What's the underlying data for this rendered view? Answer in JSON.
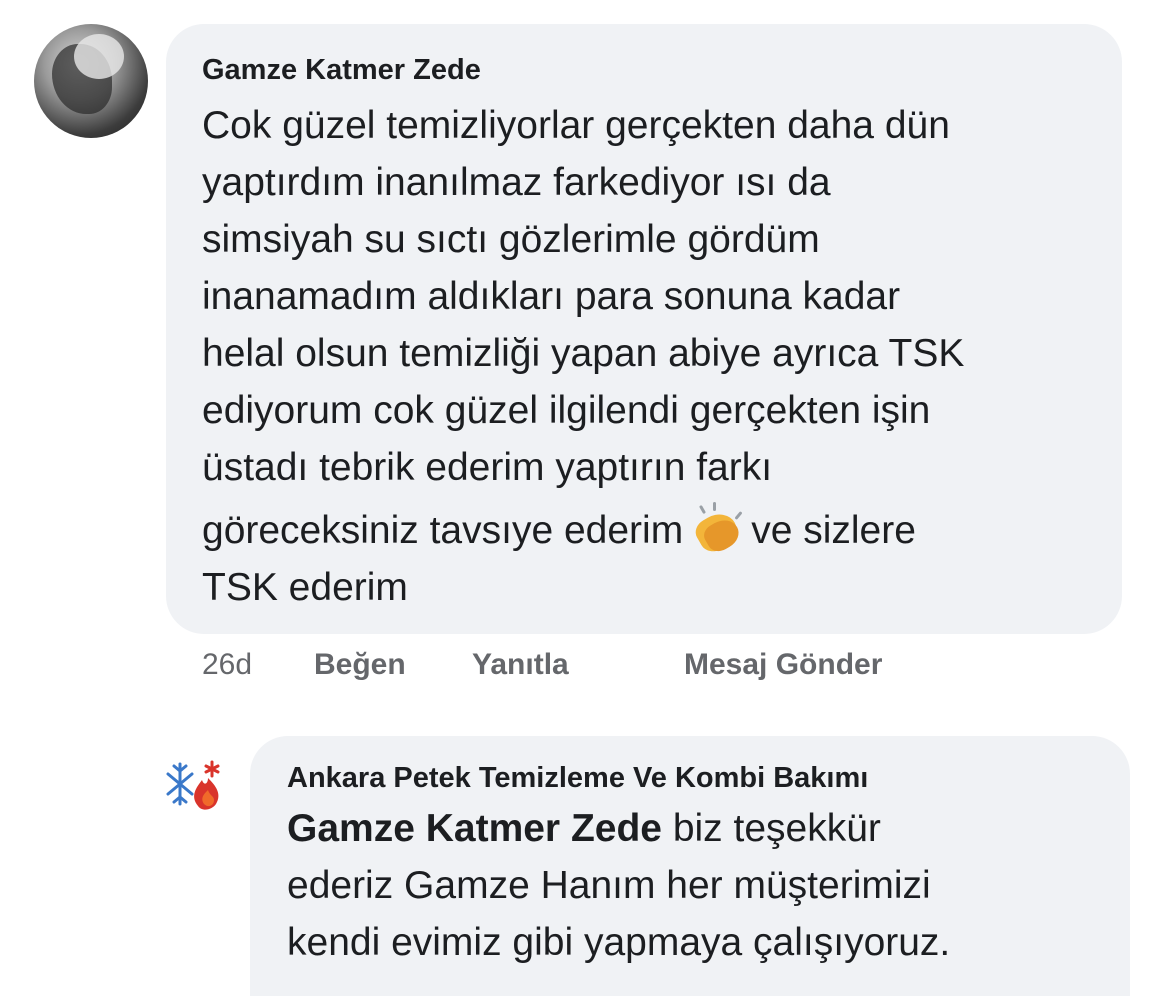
{
  "comment": {
    "author": "Gamze Katmer Zede",
    "lines": [
      "Cok güzel temizliyorlar gerçekten daha dün",
      "yaptırdım inanılmaz farkediyor ısı da",
      "simsiyah su sıctı gözlerimle gördüm",
      "inanamadım aldıkları para sonuna kadar",
      "helal olsun temizliği yapan abiye ayrıca TSK",
      "ediyorum cok güzel ilgilendi gerçekten işin",
      "üstadı tebrik ederim yaptırın farkı"
    ],
    "line8_before_emoji": "göreceksiniz tavsıye ederim",
    "emoji": "clapping-hands",
    "line8_after_emoji": "ve sizlere",
    "line9": "TSK ederim",
    "time": "26d",
    "like_label": "Beğen",
    "reply_label": "Yanıtla",
    "message_label": "Mesaj Gönder"
  },
  "reply": {
    "author": "Ankara Petek Temizleme Ve Kombi Bakımı",
    "mention": "Gamze Katmer Zede",
    "line1_rest": " biz teşekkür",
    "lines": [
      "ederiz Gamze Hanım her müşterimizi",
      "kendi evimiz gibi yapmaya çalışıyoruz."
    ]
  },
  "colors": {
    "bubble": "#f0f2f5",
    "text": "#1c1e21",
    "secondary": "#65676b"
  }
}
